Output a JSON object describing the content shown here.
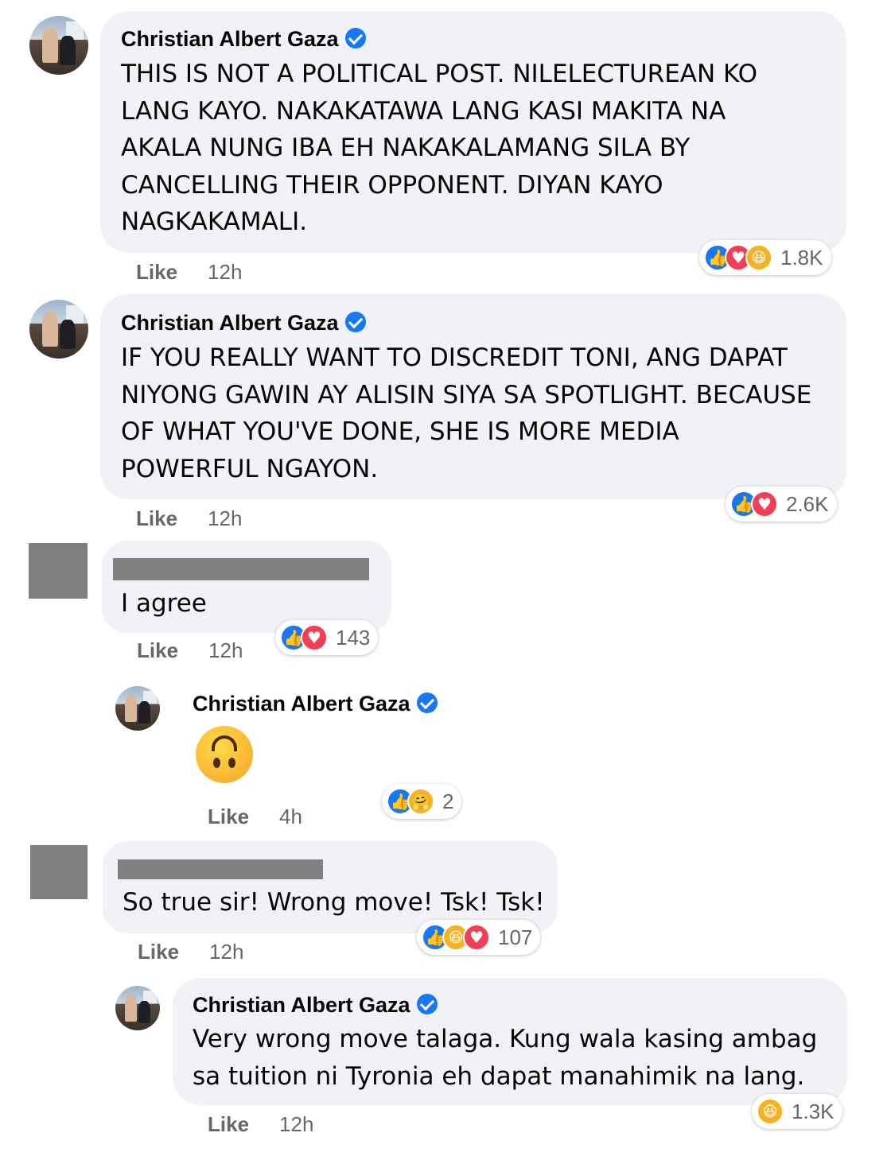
{
  "comments": [
    {
      "author": "Christian Albert Gaza",
      "verified": true,
      "text": "THIS IS NOT A POLITICAL POST. NILELECTUREAN KO\nLANG KAYO. NAKAKATAWA LANG KASI MAKITA NA\nAKALA NUNG IBA EH NAKAKALAMANG SILA BY\nCANCELLING THEIR OPPONENT. DIYAN KAYO\nNAGKAKAMALI.",
      "like_label": "Like",
      "time": "12h",
      "reactions": [
        "like",
        "love",
        "haha"
      ],
      "reaction_count": "1.8K"
    },
    {
      "author": "Christian Albert Gaza",
      "verified": true,
      "text": "IF YOU REALLY WANT TO DISCREDIT TONI, ANG DAPAT\nNIYONG GAWIN AY ALISIN SIYA SA SPOTLIGHT. BECAUSE\nOF WHAT YOU'VE DONE, SHE IS MORE MEDIA\nPOWERFUL NGAYON.",
      "like_label": "Like",
      "time": "12h",
      "reactions": [
        "like",
        "love"
      ],
      "reaction_count": "2.6K"
    },
    {
      "author": "",
      "redacted": true,
      "text": "I agree",
      "like_label": "Like",
      "time": "12h",
      "reactions": [
        "like",
        "love"
      ],
      "reaction_count": "143"
    },
    {
      "author": "Christian Albert Gaza",
      "verified": true,
      "reply": true,
      "emoji": "upside-down-face",
      "like_label": "Like",
      "time": "4h",
      "reactions": [
        "like",
        "care"
      ],
      "reaction_count": "2"
    },
    {
      "author": "",
      "redacted": true,
      "text": "So true sir! Wrong move! Tsk! Tsk!",
      "like_label": "Like",
      "time": "12h",
      "reactions": [
        "like",
        "haha",
        "love"
      ],
      "reaction_count": "107"
    },
    {
      "author": "Christian Albert Gaza",
      "verified": true,
      "reply": true,
      "text": "Very wrong move talaga. Kung wala kasing ambag\nsa tuition ni Tyronia eh dapat manahimik na lang.",
      "like_label": "Like",
      "time": "12h",
      "reactions": [
        "haha"
      ],
      "reaction_count": "1.3K"
    }
  ],
  "colors": {
    "bubble": "#f0f2f5",
    "meta_text": "#65676b",
    "verified_blue": "#1877f2",
    "like_blue": "#1877f2",
    "love_red": "#f33e58",
    "haha_yellow": "#f7b125"
  },
  "icons": {
    "like": "thumbs-up",
    "love": "heart",
    "haha": "laughing-face",
    "care": "hugging-face",
    "verified": "check-badge"
  }
}
